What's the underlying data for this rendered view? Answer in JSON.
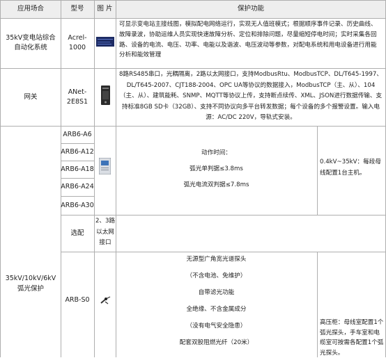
{
  "headers": {
    "app": "应用场合",
    "model": "型号",
    "image": "图 片",
    "func": "保护功能"
  },
  "row1": {
    "app": "35kV变电站综合自动化系统",
    "model": "Acrel-1000",
    "func": "可显示变电站主接线图，模拟配电网络运行，实现无人值班模式；根据顺序事件记录、历史曲线、故障录波，协助运维人员实现快速故障分析、定位和排除问题，尽量缩短停电时间；实时采集各回路、设备的电流、电压、功率、电能以及谐波、电压波动等参数，对配电系统和用电设备进行用能分析和能效管理"
  },
  "row2": {
    "app": "网关",
    "model": "ANet-2E8S1",
    "func": "8路RS485串口，光耦隔离，2路以太网接口，支持ModbusRtu、ModbusTCP、DL/T645-1997、DL/T645-2007、CJT188-2004、OPC UA等协议的数据接入，ModbusTCP（主、从）、104（主、从）、建筑能耗、SNMP、MQTT等协议上传，支持断点续传、XML、JSON进行数据传输、支持标准8GB SD卡（32GB）、支持不同协议向多平台转发数据；每个设备的多个报警设置。输入电源：AC/DC 220V，导轨式安装。"
  },
  "arc": {
    "app": "35kV/10kV/6kV弧光保护",
    "models": [
      "ARB6-A6",
      "ARB6-A12",
      "ARB6-A18",
      "ARB6-A24",
      "ARB6-A30"
    ],
    "func_title": "动作时间：",
    "func_lines": [
      "弧光单判据≤3.8ms",
      "弧光电流双判据≤7.8ms"
    ],
    "config": "0.4kV~35kV：每段母线配置1台主机。",
    "optional_label": "选配",
    "optional_image_text": "2、3路以太网接口",
    "s0_model": "ARB-S0",
    "s0_lines": [
      "无源型广角宽光谱探头",
      "（不含电池、免维护）",
      "自带滤光功能",
      "全绝缘、不含金属成分",
      "（没有电气安全隐患）",
      "配套双股阻燃光纤（20米）"
    ],
    "s0_config": "高压柜：母线室配置1个弧光探头，手车室和电缆室可按需各配置1个弧光探头。"
  },
  "colors": {
    "grid": "#aeaeae",
    "header_bg": "#eeeeee",
    "text": "#222222"
  }
}
